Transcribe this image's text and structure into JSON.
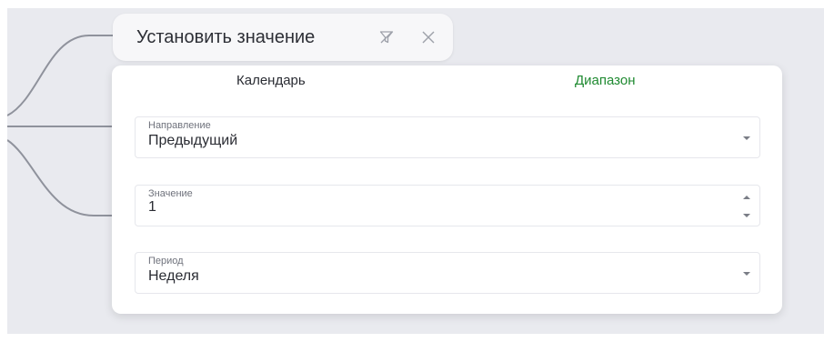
{
  "node": {
    "title": "Установить значение",
    "filter_icon": "filter-off-icon",
    "close_icon": "close-icon"
  },
  "tabs": [
    {
      "label": "Календарь",
      "active": false
    },
    {
      "label": "Диапазон",
      "active": true
    }
  ],
  "fields": {
    "direction": {
      "label": "Направление",
      "value": "Предыдущий",
      "icon": "chevron-down-icon"
    },
    "value": {
      "label": "Значение",
      "value": "1",
      "icon": "spinner-icon"
    },
    "period": {
      "label": "Период",
      "value": "Неделя",
      "icon": "chevron-down-icon"
    }
  },
  "colors": {
    "canvas": "#e9eaef",
    "connector": "#8f929c",
    "active_tab": "#1f8a31",
    "text": "#2a2c33"
  }
}
